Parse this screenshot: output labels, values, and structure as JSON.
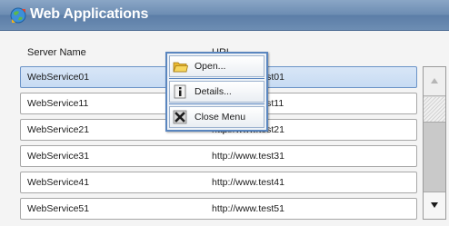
{
  "window": {
    "title": "Web Applications",
    "icon": "globe-app-icon"
  },
  "table": {
    "headers": [
      "Server Name",
      "URL"
    ],
    "rows": [
      {
        "name": "WebService01",
        "url": "http://www.test01",
        "selected": true
      },
      {
        "name": "WebService11",
        "url": "http://www.test11",
        "selected": false
      },
      {
        "name": "WebService21",
        "url": "http://www.test21",
        "selected": false
      },
      {
        "name": "WebService31",
        "url": "http://www.test31",
        "selected": false
      },
      {
        "name": "WebService41",
        "url": "http://www.test41",
        "selected": false
      },
      {
        "name": "WebService51",
        "url": "http://www.test51",
        "selected": false
      }
    ]
  },
  "context_menu": {
    "items": [
      {
        "label": "Open...",
        "icon": "folder-icon"
      },
      {
        "label": "Details...",
        "icon": "info-icon"
      },
      {
        "label": "Close Menu",
        "icon": "close-icon"
      }
    ]
  },
  "scrollbar": {
    "up_icon": "scroll-up-icon",
    "down_icon": "scroll-down-icon"
  },
  "colors": {
    "title_bar": "#6d8db3",
    "selected_row": "#c7dbf3",
    "menu_border": "#5a86bf"
  }
}
